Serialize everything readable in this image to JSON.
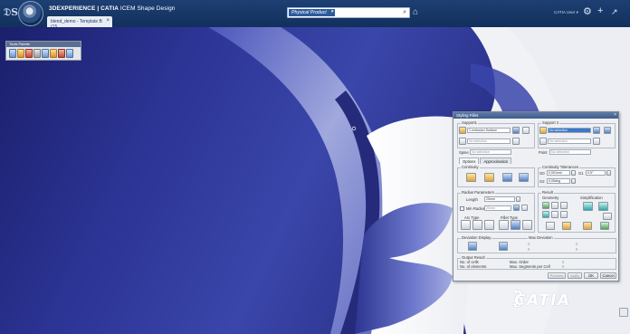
{
  "header": {
    "brand_strong": "3DEXPERIENCE | CATIA",
    "brand_rest": " ICEM Shape Design",
    "tab_label": "blend_demo - Template B (15...",
    "search_chip": "Physical Product",
    "search_caret": "▾",
    "user_label": "CATIA User ▾",
    "icons": [
      "compass-icon",
      "search-icon",
      "tag-icon",
      "share-icon",
      "add-icon",
      "tools-icon"
    ]
  },
  "toolbar": {
    "title": "Tools Palette"
  },
  "dialog": {
    "title": "Styling Fillet",
    "support1_label": "Support1",
    "support2_label": "Support 2",
    "support1_field": "1 extrusion Surface",
    "support2_field": "No selection",
    "no_selection": "No selection",
    "spine_label": "Spine",
    "point_label": "Point",
    "tabs": [
      "Options",
      "Approximation"
    ],
    "continuity_label": "Continuity",
    "continuity_tol_label": "Continuity Tolerances",
    "g0_label": "G0",
    "g0_value": "0,001mm",
    "g1_label": "G1",
    "g1_value": "0,5°",
    "g2_label": "G2",
    "g2_value": "0,05deg",
    "radius_params_label": "Radius Parameters",
    "length_label": "Length",
    "length_value": "25mm",
    "min_radius_label": "Min Radius",
    "min_radius_value": "20mm",
    "result_label": "Result",
    "geometry_label": "Geometry",
    "simplification_label": "Simplification",
    "arc_type_label": "Arc Type",
    "fillet_type_label": "Fillet Type",
    "deviation_display_label": "Deviation Display",
    "max_deviation_label": "Max Deviation",
    "output_result_label": "Output Result",
    "nb_cells_label": "No. of cells",
    "nb_elements_label": "No. of elements",
    "max_order_label": "Max. Order",
    "max_segments_label": "Max. Segments per Cell",
    "placeholder_value": "0",
    "buttons": [
      "Preview",
      "Apply",
      "OK",
      "Cancel"
    ]
  },
  "watermark": {
    "ds": "ℨ",
    "brand": "CATIA"
  }
}
